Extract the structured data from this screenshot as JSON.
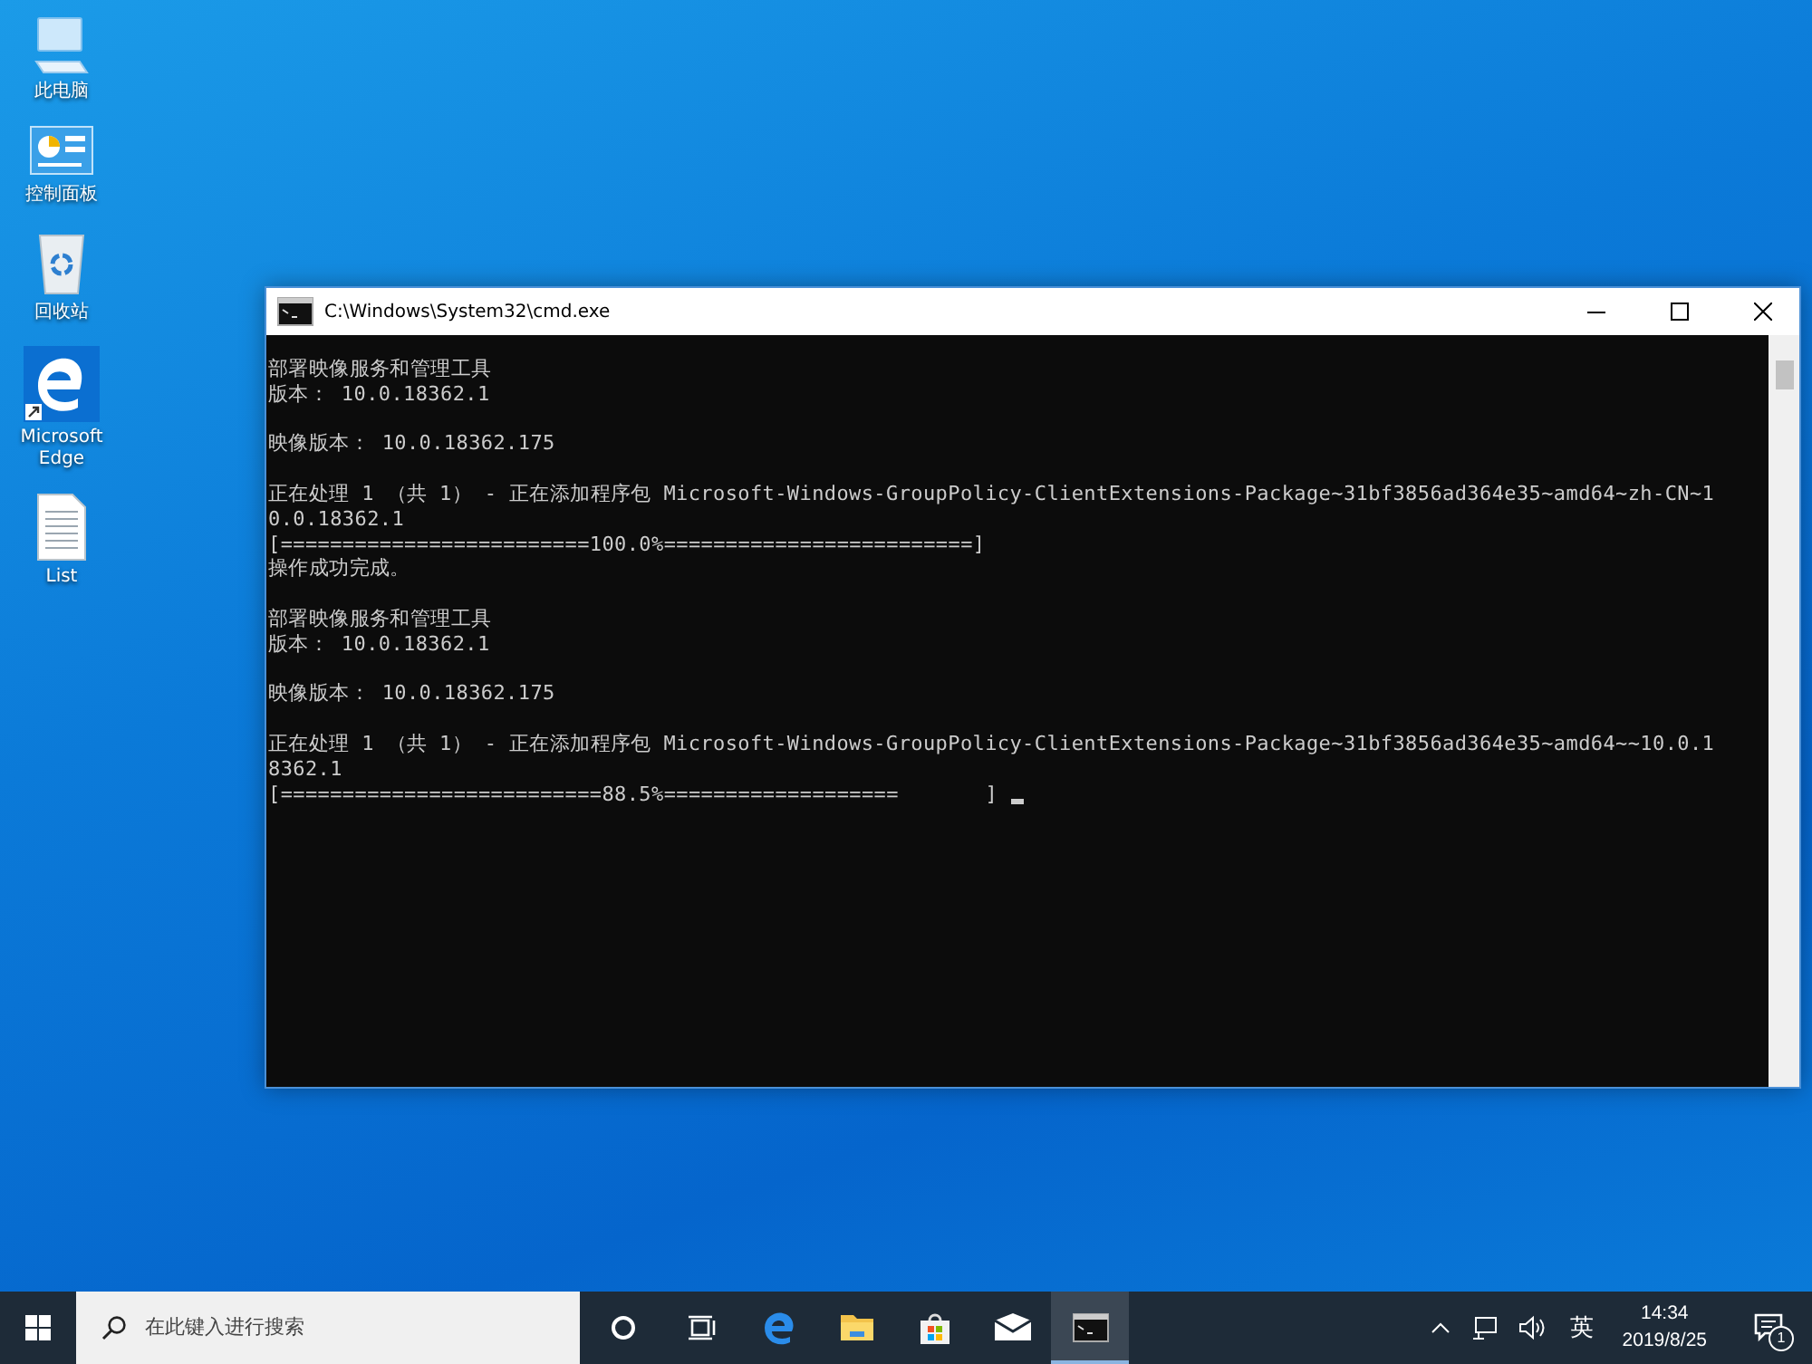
{
  "desktop": {
    "icons": [
      {
        "kind": "computer",
        "label": "此电脑"
      },
      {
        "kind": "control-panel",
        "label": "控制面板"
      },
      {
        "kind": "recycle-bin",
        "label": "回收站"
      },
      {
        "kind": "edge",
        "label": "Microsoft Edge"
      },
      {
        "kind": "document",
        "label": "List"
      }
    ]
  },
  "window": {
    "title": "C:\\Windows\\System32\\cmd.exe",
    "blocks": [
      [
        "部署映像服务和管理工具",
        "版本： 10.0.18362.1"
      ],
      [
        "映像版本： 10.0.18362.175"
      ],
      [
        "正在处理 1 （共 1） - 正在添加程序包 Microsoft-Windows-GroupPolicy-ClientExtensions-Package~31bf3856ad364e35~amd64~zh-CN~1",
        "0.0.18362.1",
        "[=========================100.0%=========================]",
        "操作成功完成。"
      ],
      [
        "部署映像服务和管理工具",
        "版本： 10.0.18362.1"
      ],
      [
        "映像版本： 10.0.18362.175"
      ],
      [
        "正在处理 1 （共 1） - 正在添加程序包 Microsoft-Windows-GroupPolicy-ClientExtensions-Package~31bf3856ad364e35~amd64~~10.0.1",
        "8362.1",
        "[==========================88.5%===================       ]"
      ]
    ]
  },
  "taskbar": {
    "search": {
      "placeholder": "在此键入进行搜索"
    },
    "apps": [
      {
        "kind": "cortana",
        "selected": false
      },
      {
        "kind": "task-view",
        "selected": false
      },
      {
        "kind": "edge",
        "selected": false
      },
      {
        "kind": "explorer",
        "selected": false
      },
      {
        "kind": "store",
        "selected": false
      },
      {
        "kind": "mail",
        "selected": false
      },
      {
        "kind": "cmd",
        "selected": true
      }
    ],
    "tray": {
      "language": "英",
      "time": "14:34",
      "date": "2019/8/25",
      "notifications": "1"
    }
  }
}
